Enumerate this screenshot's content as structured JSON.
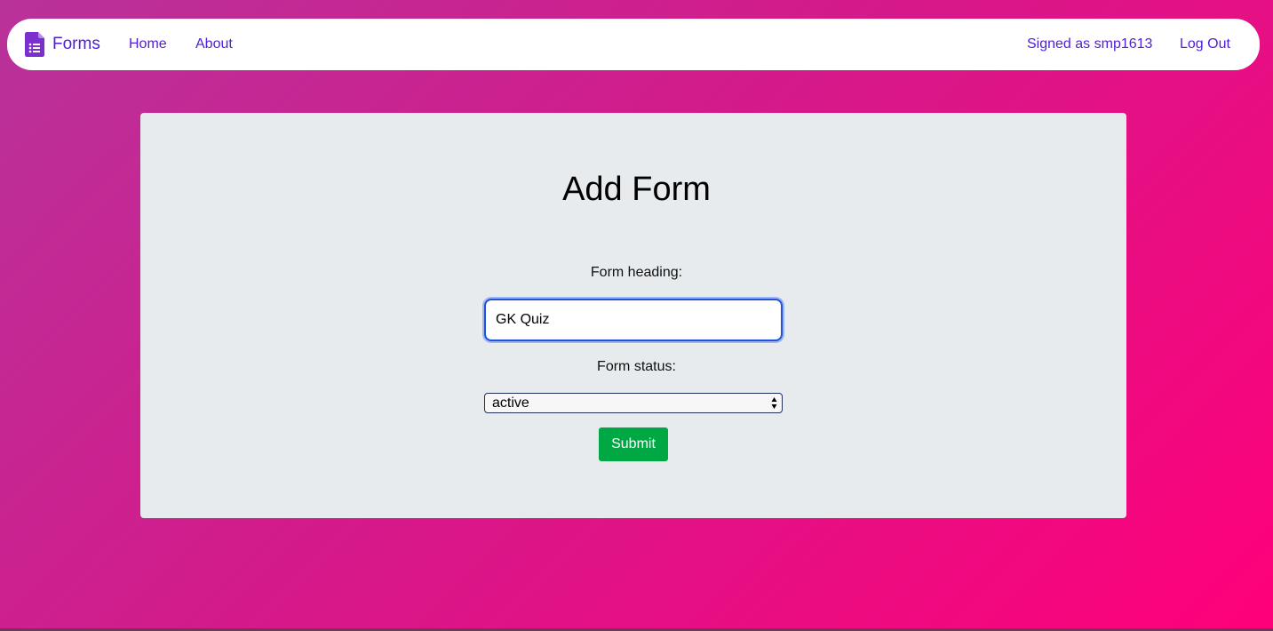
{
  "navbar": {
    "brand_label": "Forms",
    "brand_icon": "google-forms-icon",
    "home_label": "Home",
    "about_label": "About",
    "user_label": "Signed as smp1613",
    "logout_label": "Log Out",
    "link_color": "#4f1ed8"
  },
  "main": {
    "title": "Add Form",
    "heading_label": "Form heading:",
    "heading_value": "GK Quiz",
    "status_label": "Form status:",
    "status_value": "active",
    "submit_label": "Submit"
  },
  "colors": {
    "background_start": "#b8329a",
    "background_end": "#ff007a",
    "card": "#e7ebee",
    "submit": "#00a843",
    "focus_border": "#2152d8"
  }
}
